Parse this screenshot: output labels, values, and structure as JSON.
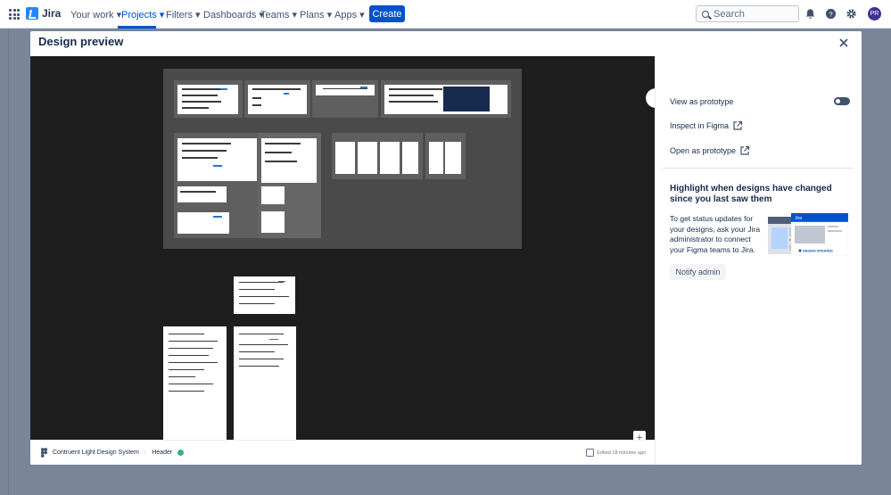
{
  "topnav": {
    "logo_text": "Jira",
    "items": [
      "Your work",
      "Projects",
      "Filters",
      "Dashboards",
      "Teams",
      "Plans",
      "Apps"
    ],
    "create_label": "Create",
    "search_placeholder": "Search",
    "avatar_initials": "PR"
  },
  "modal": {
    "title": "Design preview",
    "footer": {
      "file_name": "Contruent Light Design System",
      "separator": "·",
      "frame_name": "Header",
      "edited": "Edited 18 minutes ago"
    },
    "zoom": {
      "in": "+",
      "out": "−"
    },
    "panel": {
      "view_prototype": "View as prototype",
      "inspect_figma": "Inspect in Figma",
      "open_prototype": "Open as prototype",
      "highlight_title": "Highlight when designs have changed since you last saw them",
      "highlight_body": "To get status updates for your designs, ask your Jira administrator to connect your Figma teams to Jira.",
      "illus_jira": "Jira",
      "illus_badge": "DESIGN UPDATED",
      "notify_label": "Notify admin"
    }
  },
  "colors": {
    "brand": "#0052cc",
    "canvas": "#1e1e1e",
    "frame": "#5f5f5f",
    "overlay": "rgba(9,30,66,0.54)"
  }
}
